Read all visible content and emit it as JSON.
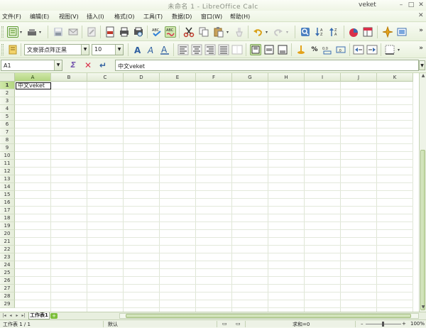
{
  "window": {
    "title": "未命名 1 - LibreOffice Calc",
    "user": "veket",
    "buttons": [
      "–",
      "□",
      "✕"
    ]
  },
  "menu": {
    "items": [
      "文件(F)",
      "编辑(E)",
      "视图(V)",
      "插入(I)",
      "格式(O)",
      "工具(T)",
      "数据(D)",
      "窗口(W)",
      "帮助(H)"
    ],
    "close": "✕"
  },
  "format_toolbar": {
    "font_name": "文泉驿点阵正黑",
    "font_size": "10",
    "more": "»"
  },
  "standard_toolbar": {
    "more": "»"
  },
  "formula_bar": {
    "name_box": "A1",
    "content": "中文veket",
    "sum_glyph": "Σ",
    "cancel_glyph": "✕",
    "accept_glyph": "↵"
  },
  "sheet": {
    "columns": [
      "A",
      "B",
      "C",
      "D",
      "E",
      "F",
      "G",
      "H",
      "I",
      "J",
      "K"
    ],
    "rows": [
      "1",
      "2",
      "3",
      "4",
      "5",
      "6",
      "7",
      "8",
      "9",
      "10",
      "11",
      "12",
      "13",
      "14",
      "15",
      "16",
      "17",
      "18",
      "19",
      "20",
      "21",
      "22",
      "23",
      "24",
      "25",
      "26",
      "27",
      "28",
      "29"
    ],
    "selected_column": "A",
    "selected_row": "1",
    "cells": {
      "A1": "中文veket"
    },
    "tabs": [
      "工作表1"
    ],
    "add_tab": "+"
  },
  "status": {
    "sheet_pos": "工作表 1 / 1",
    "page_style": "默认",
    "sum": "求和=0",
    "zoom": "100%",
    "zoom_minus": "–",
    "zoom_plus": "+"
  },
  "colors": {
    "accent": "#8cc152",
    "selected_header": "#b3d680",
    "toolbar_bg": "#eef4e4"
  }
}
